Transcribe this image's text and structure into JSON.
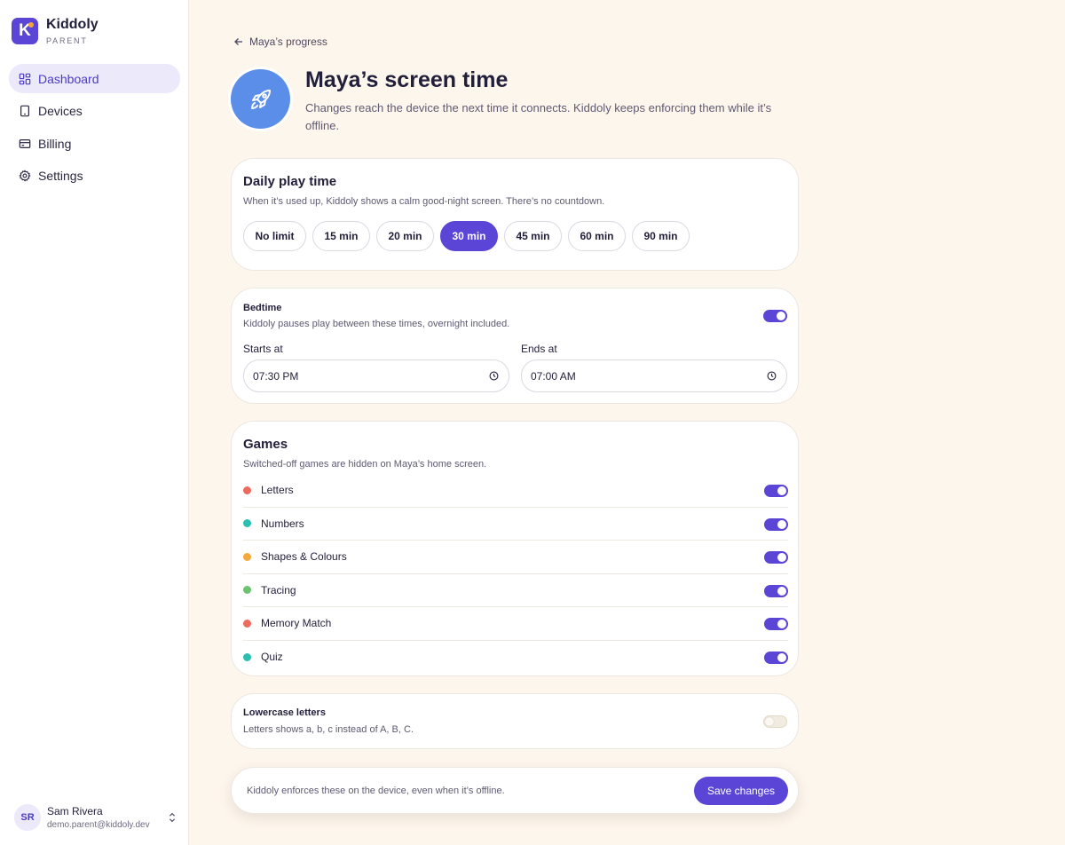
{
  "brand": {
    "name": "Kiddoly",
    "sub": "PARENT",
    "logo_letter": "K"
  },
  "nav": {
    "items": [
      {
        "label": "Dashboard",
        "icon": "dashboard-grid-icon",
        "active": true
      },
      {
        "label": "Devices",
        "icon": "device-icon",
        "active": false
      },
      {
        "label": "Billing",
        "icon": "credit-card-icon",
        "active": false
      },
      {
        "label": "Settings",
        "icon": "gear-icon",
        "active": false
      }
    ]
  },
  "user": {
    "initials": "SR",
    "name": "Sam Rivera",
    "email": "demo.parent@kiddoly.dev"
  },
  "back_link": "Maya’s progress",
  "hero": {
    "icon": "rocket-icon",
    "title": "Maya’s screen time",
    "description": "Changes reach the device the next time it connects. Kiddoly keeps enforcing them while it’s offline."
  },
  "play_time": {
    "title": "Daily play time",
    "description": "When it’s used up, Kiddoly shows a calm good-night screen. There’s no countdown.",
    "options": [
      "No limit",
      "15 min",
      "20 min",
      "30 min",
      "45 min",
      "60 min",
      "90 min"
    ],
    "selected": "30 min"
  },
  "bedtime": {
    "title": "Bedtime",
    "description": "Kiddoly pauses play between these times, overnight included.",
    "enabled": true,
    "starts_label": "Starts at",
    "starts_value": "07:30 PM",
    "ends_label": "Ends at",
    "ends_value": "07:00 AM"
  },
  "games": {
    "title": "Games",
    "description": "Switched-off games are hidden on Maya’s home screen.",
    "items": [
      {
        "name": "Letters",
        "color": "#ec6a5e",
        "enabled": true
      },
      {
        "name": "Numbers",
        "color": "#2bbfb0",
        "enabled": true
      },
      {
        "name": "Shapes & Colours",
        "color": "#f5a93a",
        "enabled": true
      },
      {
        "name": "Tracing",
        "color": "#6cc36f",
        "enabled": true
      },
      {
        "name": "Memory Match",
        "color": "#ec6a5e",
        "enabled": true
      },
      {
        "name": "Quiz",
        "color": "#2bbfb0",
        "enabled": true
      }
    ]
  },
  "lowercase": {
    "title": "Lowercase letters",
    "description": "Letters shows a, b, c instead of A, B, C.",
    "enabled": false
  },
  "savebar": {
    "text": "Kiddoly enforces these on the device, even when it’s offline.",
    "button": "Save changes"
  },
  "colors": {
    "accent": "#5b45d6",
    "background": "#fdf6ec",
    "hero_icon_bg": "#5b8ee8"
  }
}
